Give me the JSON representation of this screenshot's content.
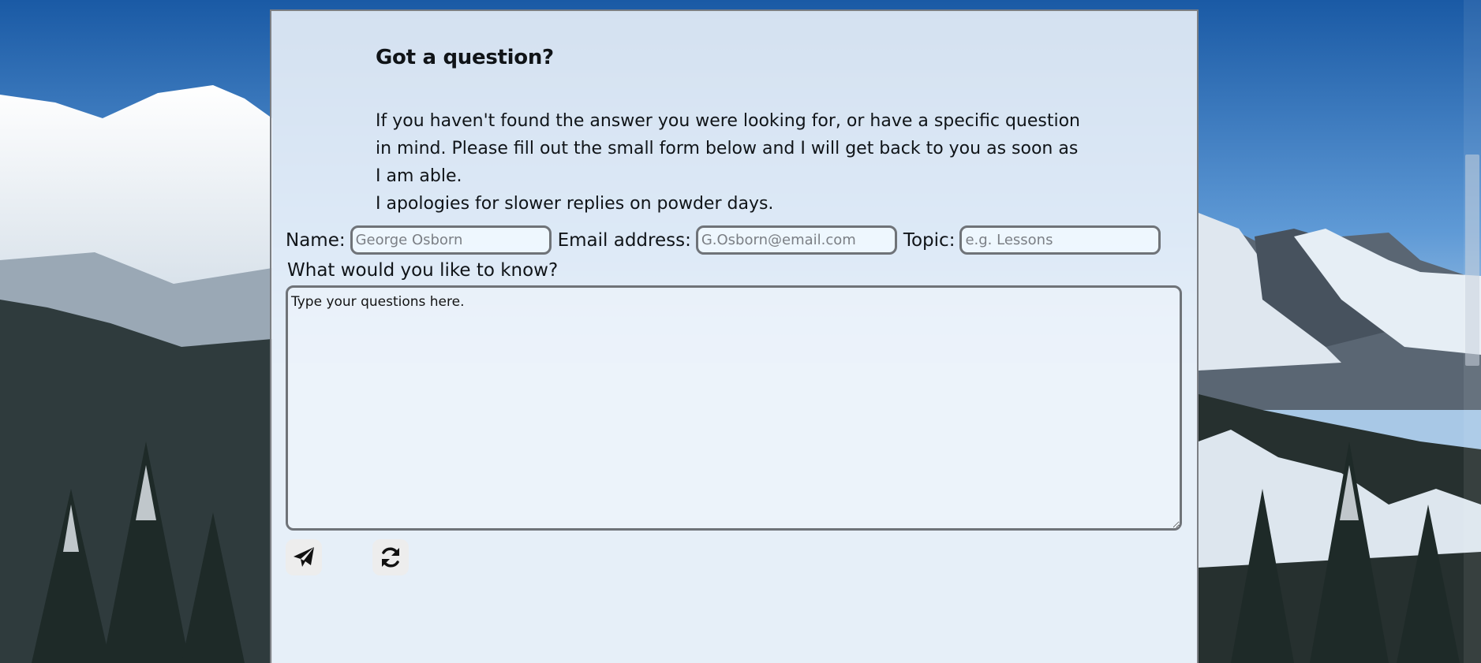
{
  "form": {
    "title": "Got a question?",
    "intro_line1": "If you haven't found the answer you were looking for, or have a specific question in mind. Please fill out the small form below and I will get back to you as soon as I am able.",
    "intro_line2": "I apologies for slower replies on powder days.",
    "name_label": "Name:",
    "name_placeholder": "George Osborn",
    "email_label": "Email address:",
    "email_placeholder": "G.Osborn@email.com",
    "topic_label": "Topic:",
    "topic_placeholder": "e.g. Lessons",
    "question_label": "What would you like to know?",
    "question_placeholder": "Type your questions here.",
    "send_icon": "paper-plane-icon",
    "reset_icon": "refresh-icon"
  },
  "colors": {
    "panel_border": "#7c7f84",
    "field_border": "#6f7378",
    "button_bg": "#ededed",
    "text": "#101418"
  }
}
